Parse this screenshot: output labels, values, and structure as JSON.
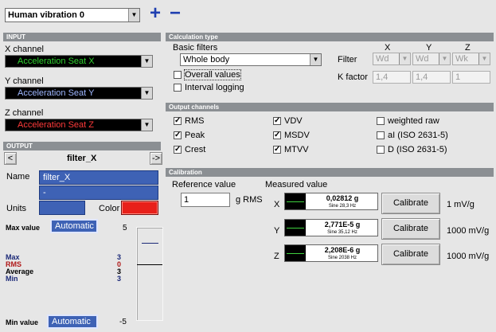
{
  "header": {
    "profile": "Human vibration 0",
    "add_symbol": "+",
    "remove_symbol": "−"
  },
  "input": {
    "title": "INPUT",
    "x_label": "X channel",
    "x_value": "Acceleration Seat X",
    "y_label": "Y channel",
    "y_value": "Acceleration Seat Y",
    "z_label": "Z channel",
    "z_value": "Acceleration Seat Z",
    "colors": {
      "x": "#2fd12f",
      "y": "#9fb7ff",
      "z": "#ff3a3a"
    }
  },
  "output": {
    "title": "OUTPUT",
    "prev": "<",
    "next": "->",
    "filter_name": "filter_X",
    "name_label": "Name",
    "name_value": "filter_X",
    "name_value2": "-",
    "units_label": "Units",
    "units_value": "",
    "color_label": "Color",
    "color_value": "#e8201a",
    "max_label": "Max value",
    "max_button": "Automatic",
    "min_label": "Min value",
    "min_button": "Automatic",
    "scale_top": "5",
    "scale_bottom": "-5",
    "level": 3,
    "stats": [
      {
        "key": "Max",
        "value": "3",
        "color": "#1c2a78"
      },
      {
        "key": "RMS",
        "value": "0",
        "color": "#b01818"
      },
      {
        "key": "Average",
        "value": "3",
        "color": "#000000"
      },
      {
        "key": "Min",
        "value": "3",
        "color": "#1c2a78"
      }
    ]
  },
  "calc": {
    "title": "Calculation type",
    "basic_filters_label": "Basic filters",
    "basic_filters_value": "Whole body",
    "overall_label": "Overall values",
    "overall_checked": false,
    "interval_label": "Interval logging",
    "interval_checked": false,
    "col_x": "X",
    "col_y": "Y",
    "col_z": "Z",
    "filter_label": "Filter",
    "filter_x": "Wd",
    "filter_y": "Wd",
    "filter_z": "Wk",
    "kfactor_label": "K factor",
    "k_x": "1,4",
    "k_y": "1,4",
    "k_z": "1"
  },
  "output_channels": {
    "title": "Output channels",
    "items": [
      {
        "label": "RMS",
        "checked": true
      },
      {
        "label": "VDV",
        "checked": true
      },
      {
        "label": "weighted raw",
        "checked": false
      },
      {
        "label": "Peak",
        "checked": true
      },
      {
        "label": "MSDV",
        "checked": true
      },
      {
        "label": "aI (ISO 2631-5)",
        "checked": false
      },
      {
        "label": "Crest",
        "checked": true
      },
      {
        "label": "MTVV",
        "checked": true
      },
      {
        "label": "D (ISO 2631-5)",
        "checked": false
      }
    ]
  },
  "calibration": {
    "title": "Calibration",
    "reference_label": "Reference value",
    "reference_value": "1",
    "reference_unit": "g RMS",
    "measured_label": "Measured value",
    "rows": [
      {
        "axis": "X",
        "value": "0,02812 g",
        "sine": "Sine 28,3 Hz",
        "button": "Calibrate",
        "sensitivity": "1 mV/g"
      },
      {
        "axis": "Y",
        "value": "2,771E-5 g",
        "sine": "Sine 35,12 Hz",
        "button": "Calibrate",
        "sensitivity": "1000 mV/g"
      },
      {
        "axis": "Z",
        "value": "2,208E-6 g",
        "sine": "Sine 2038 Hz",
        "button": "Calibrate",
        "sensitivity": "1000 mV/g"
      }
    ]
  }
}
